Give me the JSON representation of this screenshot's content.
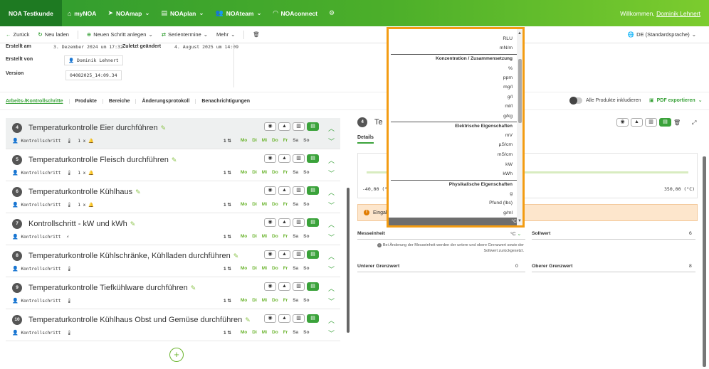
{
  "topbar": {
    "brand": "NOA Testkunde",
    "nav": [
      {
        "label": "myNOA",
        "icon": "home-icon"
      },
      {
        "label": "NOAmap",
        "icon": "cursor-icon"
      },
      {
        "label": "NOAplan",
        "icon": "document-icon"
      },
      {
        "label": "NOAteam",
        "icon": "team-icon"
      },
      {
        "label": "NOAconnect",
        "icon": "wifi-icon"
      }
    ],
    "welcome_prefix": "Willkommen, ",
    "welcome_user": "Dominik Lehnert"
  },
  "toolbar": {
    "back": "Zurück",
    "reload": "Neu laden",
    "new_step": "Neuen Schritt anlegen",
    "series": "Serientermine",
    "more": "Mehr",
    "language": "DE (Standardsprache)"
  },
  "meta": {
    "created_on_label": "Erstellt am",
    "created_on_value": "3. Dezember 2024 um 17:32",
    "changed_label": "Zuletzt geändert",
    "changed_value": "4. August 2025 um 14:09",
    "created_by_label": "Erstellt von",
    "created_by_value": "Dominik Lehnert",
    "version_label": "Version",
    "version_value": "04082025_14:09.34"
  },
  "tabs": [
    "Arbeits-/Kontrollschritte",
    "Produkte",
    "Bereiche",
    "Änderungsprotokoll",
    "Benachrichtigungen"
  ],
  "include_products": "Alle Produkte inkludieren",
  "pdf_export": "PDF exportieren",
  "step_type": "Kontrollschritt",
  "days": [
    "Mo",
    "Di",
    "Mi",
    "Do",
    "Fr",
    "Sa",
    "So"
  ],
  "steps": [
    {
      "num": "4",
      "title": "Temperaturkontrolle Eier durchführen",
      "reminder": "1 x",
      "repeat": "1"
    },
    {
      "num": "5",
      "title": "Temperaturkontrolle Fleisch durchführen",
      "reminder": "1 x",
      "repeat": "1"
    },
    {
      "num": "6",
      "title": "Temperaturkontrolle Kühlhaus",
      "reminder": "1 x",
      "repeat": "1"
    },
    {
      "num": "7",
      "title": "Kontrollschritt - kW und kWh",
      "reminder": "",
      "repeat": "1"
    },
    {
      "num": "8",
      "title": "Temperaturkontrolle Kühlschränke, Kühlladen durchführen",
      "reminder": "",
      "repeat": "1"
    },
    {
      "num": "9",
      "title": "Temperaturkontrolle Tiefkühlware durchführen",
      "reminder": "",
      "repeat": "1"
    },
    {
      "num": "10",
      "title": "Temperaturkontrolle Kühlhaus Obst und Gemüse durchführen",
      "reminder": "",
      "repeat": "1"
    }
  ],
  "detail": {
    "num": "4",
    "title": "Te",
    "tab": "Details",
    "range_min": "-40,00 (°",
    "range_max": "350,00 (°C)",
    "warning": "Eingab",
    "unit_label": "Messeinheit",
    "unit_value": "°C",
    "target_label": "Sollwert",
    "target_value": "6",
    "hint": "Bei Änderung der Messeinheit werden der untere und obere Grenzwert sowie der Sollwert zurückgesetzt.",
    "lower_label": "Unterer Grenzwert",
    "lower_value": "0",
    "upper_label": "Oberer Grenzwert",
    "upper_value": "8"
  },
  "dropdown": {
    "items_top": [
      "RLU",
      "mN/m"
    ],
    "group1": "Konzentration / Zusammensetzung",
    "items1": [
      "%",
      "ppm",
      "mg/l",
      "g/l",
      "ml/l",
      "g/kg"
    ],
    "group2": "Elektrische Eigenschaften",
    "items2": [
      "mV",
      "µS/cm",
      "mS/cm",
      "kW",
      "kWh"
    ],
    "group3": "Physikalische Eigenschaften",
    "items3": [
      "g",
      "Pfund (lbs)",
      "g/ml"
    ],
    "selected": "°C"
  }
}
